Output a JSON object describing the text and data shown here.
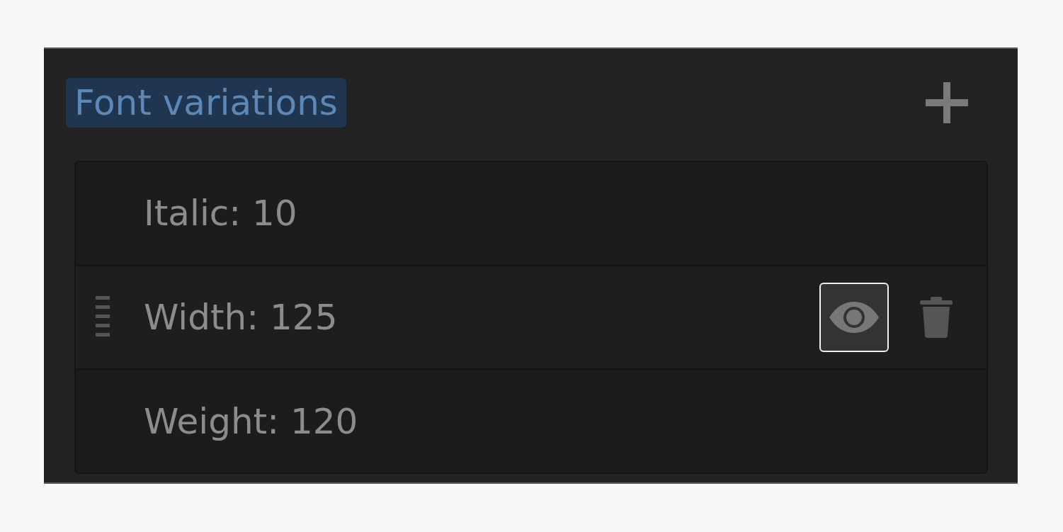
{
  "panel": {
    "title": "Font variations",
    "title_selected": true,
    "variations": [
      {
        "label": "Italic: 10",
        "hovered": false
      },
      {
        "label": "Width: 125",
        "hovered": true
      },
      {
        "label": "Weight: 120",
        "hovered": false
      }
    ]
  }
}
